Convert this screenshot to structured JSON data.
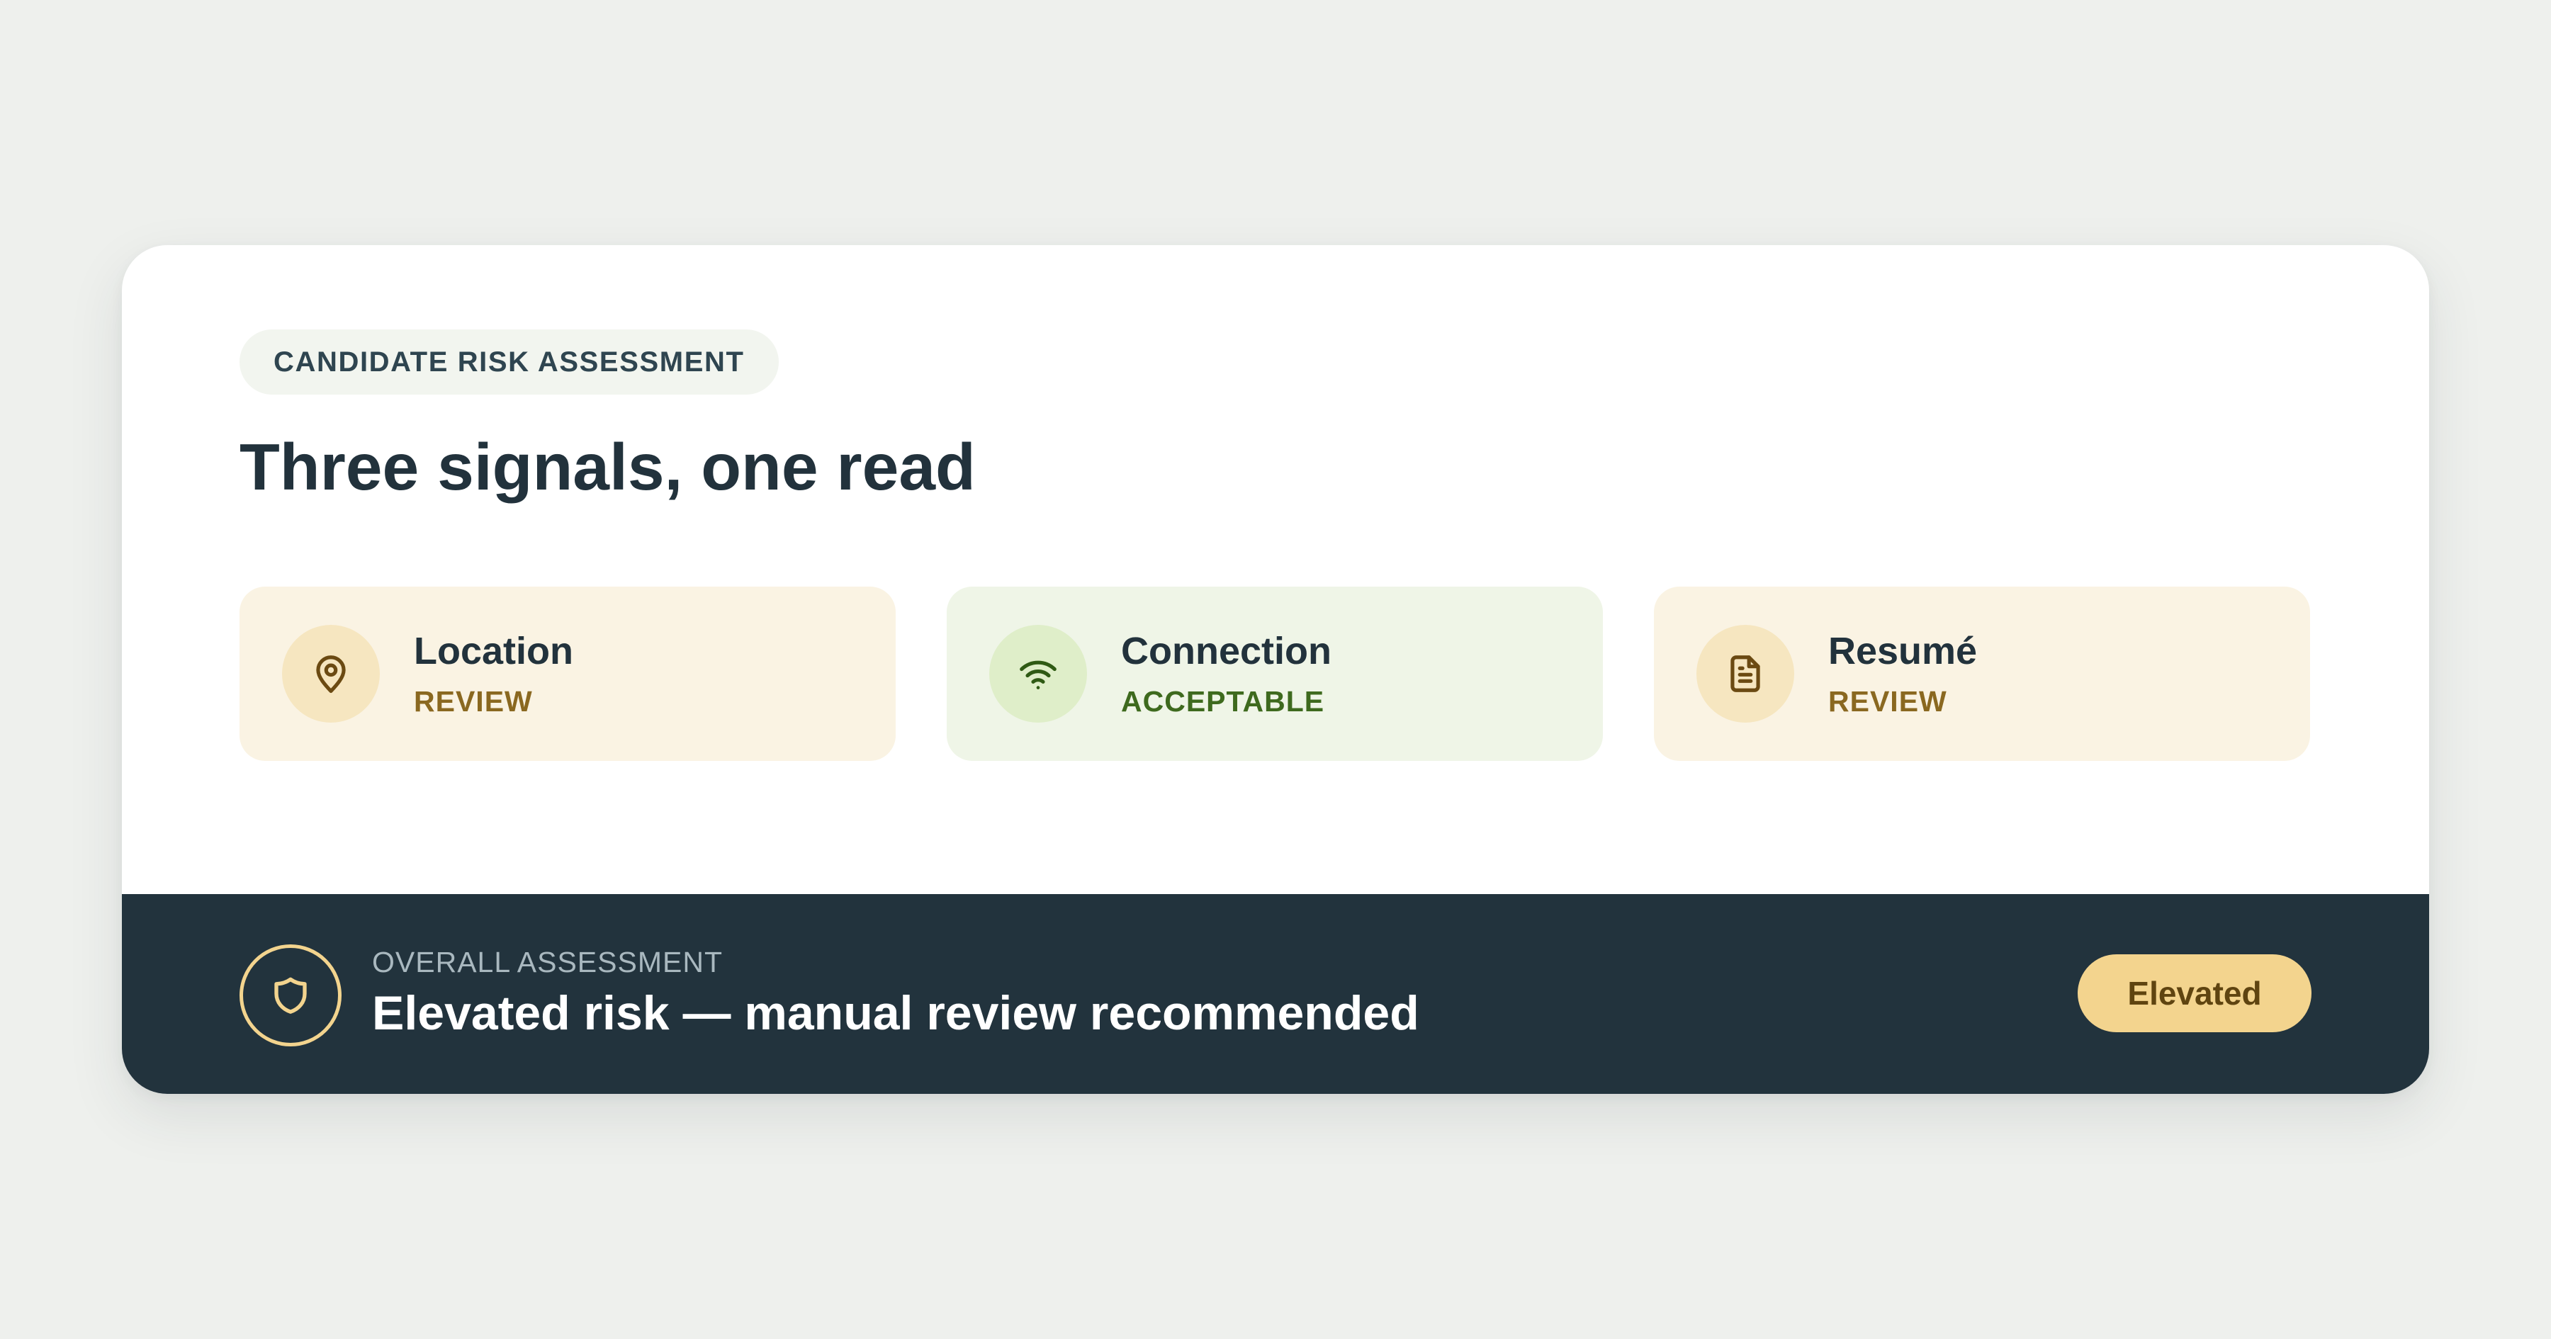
{
  "header": {
    "eyebrow": "CANDIDATE RISK ASSESSMENT",
    "title": "Three signals, one read"
  },
  "signals": [
    {
      "icon": "location-pin-icon",
      "name": "Location",
      "status": "REVIEW",
      "tone": "review"
    },
    {
      "icon": "wifi-icon",
      "name": "Connection",
      "status": "ACCEPTABLE",
      "tone": "acceptable"
    },
    {
      "icon": "document-icon",
      "name": "Resumé",
      "status": "REVIEW",
      "tone": "review"
    }
  ],
  "overall": {
    "icon": "shield-icon",
    "label": "OVERALL ASSESSMENT",
    "verdict": "Elevated risk — manual review recommended",
    "level": "Elevated"
  },
  "colors": {
    "page_background": "#eef0ed",
    "card_background": "#ffffff",
    "footer_background": "#22333d",
    "review_tint": "#faf3e3",
    "acceptable_tint": "#eff5e7",
    "elevated_accent": "#f3d48e"
  }
}
